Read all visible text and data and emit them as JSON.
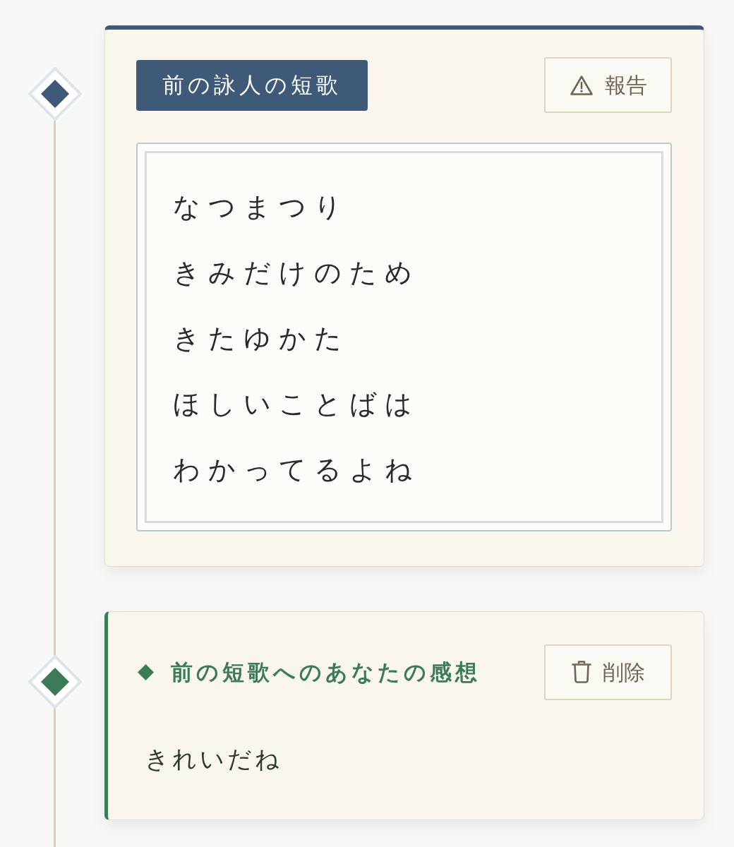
{
  "timeline": [
    {
      "kind": "poem",
      "color": "#3f5a78",
      "label": "前の詠人の短歌",
      "action": {
        "kind": "report",
        "label": "報告"
      },
      "lines": [
        "なつまつり",
        "きみだけのため",
        "きたゆかた",
        "ほしいことばは",
        "わかってるよね"
      ]
    },
    {
      "kind": "comment",
      "color": "#3d7a58",
      "title": "前の短歌へのあなたの感想",
      "action": {
        "kind": "delete",
        "label": "削除"
      },
      "text": "きれいだね"
    }
  ]
}
